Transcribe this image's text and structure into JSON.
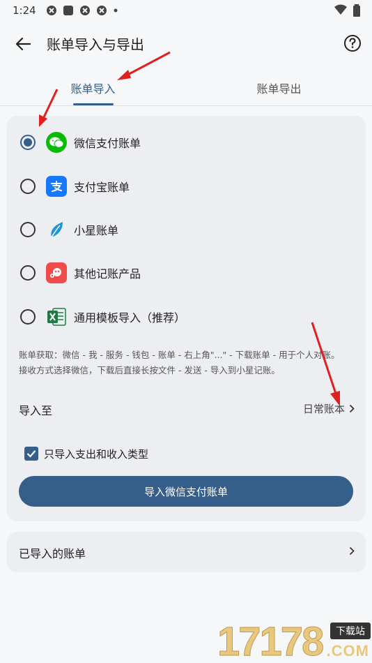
{
  "status_bar": {
    "time": "1:24",
    "icons": [
      "app-notification-icon",
      "square-icon",
      "app-notification-icon",
      "app-notification-icon",
      "dot-icon"
    ],
    "right_icons": [
      "wifi-icon",
      "battery-icon"
    ]
  },
  "app_bar": {
    "title": "账单导入与导出",
    "back_icon": "arrow-left-icon",
    "help_icon": "question-circle-icon"
  },
  "tabs": [
    {
      "label": "账单导入",
      "selected": true
    },
    {
      "label": "账单导出",
      "selected": false
    }
  ],
  "sources": [
    {
      "label": "微信支付账单",
      "icon": "wechat-icon",
      "color": "#09bb07",
      "selected": true
    },
    {
      "label": "支付宝账单",
      "icon": "alipay-icon",
      "color": "#1677ff",
      "selected": false
    },
    {
      "label": "小星账单",
      "icon": "leaf-icon",
      "color": "#1b97d6",
      "selected": false
    },
    {
      "label": "其他记账产品",
      "icon": "other-app-icon",
      "color": "#f04b4b",
      "selected": false
    },
    {
      "label": "通用模板导入（推荐）",
      "icon": "excel-icon",
      "color": "#1f7a46",
      "selected": false
    }
  ],
  "description": {
    "line1": "账单获取：微信 - 我 - 服务 - 钱包 - 账单 - 右上角\"...\" - 下载账单 - 用于个人对账。",
    "line2": "接收方式选择微信，下载后直接长按文件 - 发送 - 导入到小星记账。"
  },
  "import_to": {
    "label": "导入至",
    "value": "日常账本"
  },
  "filter_option": {
    "label": "只导入支出和收入类型",
    "checked": true
  },
  "primary_button": {
    "label": "导入微信支付账单"
  },
  "imported_bills": {
    "label": "已导入的账单"
  },
  "watermark": {
    "number": "17178",
    "badge": "下载站",
    "suffix": ".COM"
  },
  "colors": {
    "accent": "#355f8a",
    "annotation_arrow": "#e02020",
    "card_background": "#edeef1",
    "page_background": "#f6f7f9"
  }
}
